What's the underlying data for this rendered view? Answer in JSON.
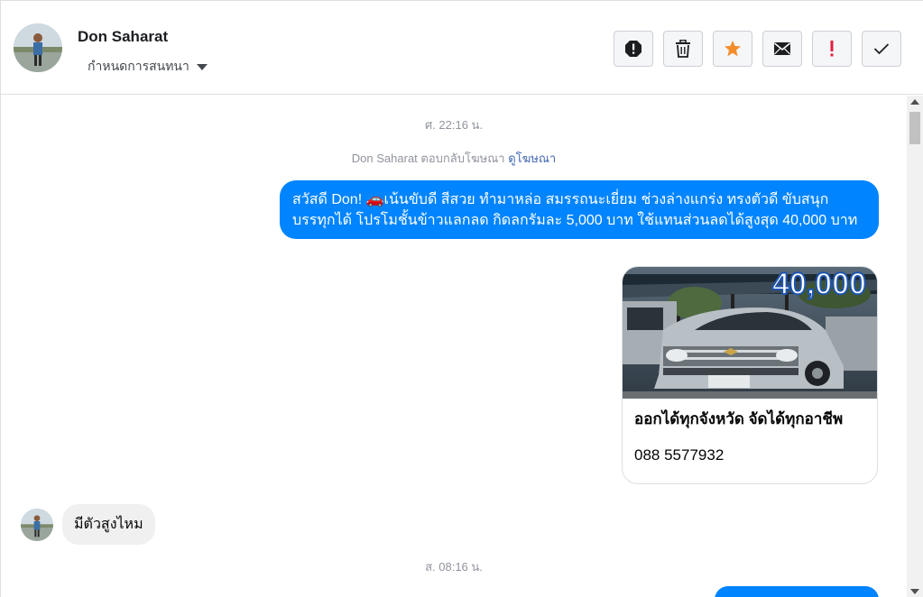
{
  "header": {
    "name": "Don Saharat",
    "assign_label": "กำหนดการสนทนา",
    "actions": [
      {
        "name": "spam-icon"
      },
      {
        "name": "trash-icon"
      },
      {
        "name": "star-icon",
        "color": "#f28d2c"
      },
      {
        "name": "envelope-icon"
      },
      {
        "name": "exclamation-icon",
        "color": "#e41e3f"
      },
      {
        "name": "check-icon"
      }
    ]
  },
  "thread": {
    "timestamp1": "ศ. 22:16 น.",
    "reply_prefix": "Don Saharat ตอบกลับโฆษณา",
    "reply_link": "ดูโฆษณา",
    "outgoing1": "สวัสดี Don! 🚗เน้นขับดี สีสวย ทำมาหล่อ สมรรถนะเยี่ยม ช่วงล่างแกร่ง ทรงตัวดี ขับสนุก บรรทุกได้ โปรโมชั้นข้าวแลกลด กิดลกรัมละ 5,000 บาท ใช้แทนส่วนลดได้สูงสุด 40,000 บาท",
    "card": {
      "image_badge": "40,000",
      "title": "ออกได้ทุกจังหวัด จัดได้ทุกอาชีพ",
      "description": "088 5577932"
    },
    "incoming1": "มีตัวสูงไหม",
    "timestamp2": "ส. 08:16 น."
  },
  "colors": {
    "accent": "#0084ff",
    "link": "#4267b2",
    "muted": "#90949c"
  }
}
